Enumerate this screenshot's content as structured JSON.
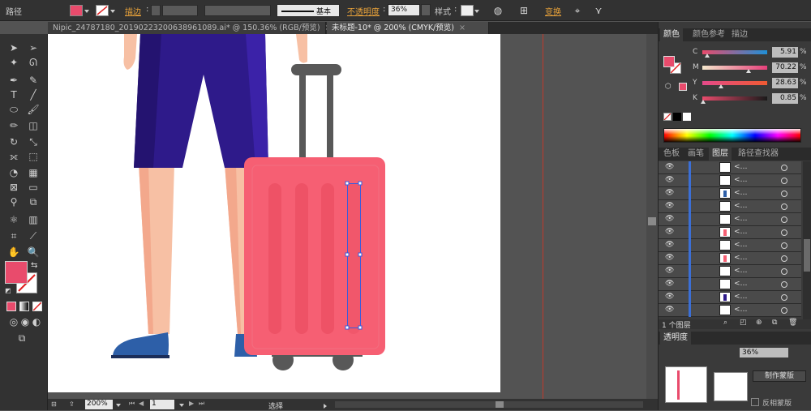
{
  "control_bar": {
    "object_type": "路径",
    "stroke_label": "描边",
    "stroke_style": "基本",
    "opacity_label": "不透明度",
    "opacity_value": "36%",
    "style_label": "样式",
    "transform_label": "变换",
    "fill_color": "#e94b6c"
  },
  "tabs": [
    {
      "label": "Nipic_24787180_20190223200638961089.ai* @ 150.36% (RGB/预览)"
    },
    {
      "label": "未标题-10* @ 200% (CMYK/预览)"
    }
  ],
  "color_panel": {
    "tabs": [
      "颜色",
      "颜色参考",
      "描边"
    ],
    "channels": [
      {
        "name": "C",
        "value": "5.91",
        "fraction": 0.06
      },
      {
        "name": "M",
        "value": "70.22",
        "fraction": 0.7
      },
      {
        "name": "Y",
        "value": "28.63",
        "fraction": 0.29
      },
      {
        "name": "K",
        "value": "0.85",
        "fraction": 0.01
      }
    ],
    "percent": "%"
  },
  "layers_panel": {
    "tabs": [
      "色板",
      "画笔",
      "图层",
      "路径查找器"
    ],
    "rows": 12,
    "footer": "1 个图层"
  },
  "transparency_panel": {
    "tabs": [
      "透明度"
    ],
    "opacity_value": "36%",
    "make_mask_label": "制作蒙版",
    "invert_mask_label": "反相蒙版"
  },
  "status": {
    "zoom": "200%",
    "page": "1",
    "tool": "选择"
  },
  "colors": {
    "suitcase": "#f65f73",
    "suitcase_stripe": "#ee5266",
    "handle": "#585858",
    "shorts": "#2e1a8a",
    "skin": "#f7c0a4",
    "shoe": "#2d5fa8",
    "accent": "#e94b6c"
  }
}
